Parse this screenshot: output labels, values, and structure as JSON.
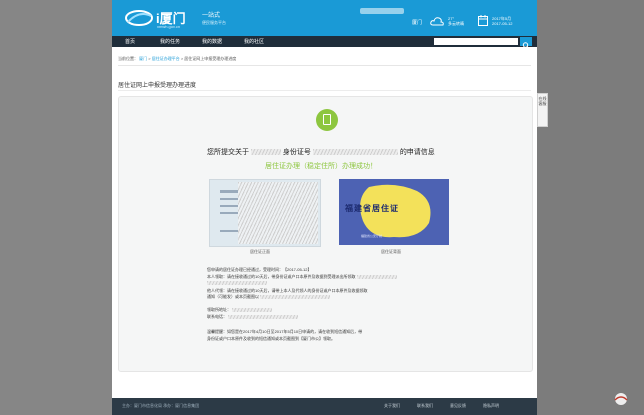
{
  "header": {
    "logo_text": "i厦门",
    "logo_sub": "xmwh.gov.cn",
    "slogan_line1": "一站式",
    "slogan_line2": "便民服务平台",
    "city": "厦门",
    "weather_line1": "27°",
    "weather_line2": "多云转晴",
    "date_line1": "2017年5月",
    "date_line2": "2017-05-12"
  },
  "nav": {
    "items": [
      "首页",
      "我的任务",
      "我的数据",
      "我的社区"
    ],
    "search_placeholder": ""
  },
  "breadcrumb": {
    "prefix": "当前位置：",
    "items": [
      "厦门",
      "居住证办理平台",
      "居住证网上申报受理办理进度"
    ]
  },
  "section_title": "居住证网上申报受理办理进度",
  "result": {
    "line_prefix": "您所提交关于",
    "line_mid": "身份证号",
    "line_suffix": "的申请信息",
    "success_text": "居住证办理（稳定住所）办理成功！",
    "front_caption": "居住证正面",
    "back_caption": "居住证背面",
    "card_title": "福建省居住证",
    "card_footer": "福建省公安厅制"
  },
  "notice": {
    "line1": "您申请的居住证办理已经通过，受理时间：【2017-05-12】",
    "line2": "本人领取：请在接收通过的10天后，带身份证或户口本原件及收据到受理派出所领取",
    "line3": "他人代领：请在接收通过的10天后，请带上本人及代领人的身份证或户口本原件及收据领取",
    "line4": "通知（可能发）或本页截图以",
    "line5": "领取所地址：",
    "line6": "联系电话：",
    "line7": "温馨提醒：如您是在2017年4月10日至2017年5月10日申请的，请在收到短信通知后，带",
    "line8": "身份证或户口本原件及收到的短信通知或本页截图到【厦门市公】领取。",
    "date_highlight": "【2017-05-12】"
  },
  "footer": {
    "copyright": "主办：厦门市信息化局 承办：厦门信息集团",
    "links": [
      "关于我们",
      "联系我们",
      "意见反馈",
      "隐私声明"
    ]
  },
  "side_tab": "在线客服",
  "colors": {
    "header_blue": "#1a9ad6",
    "nav_dark": "#1f2d3a",
    "success_green": "#8dc63f",
    "card_blue": "#4d62b3"
  }
}
